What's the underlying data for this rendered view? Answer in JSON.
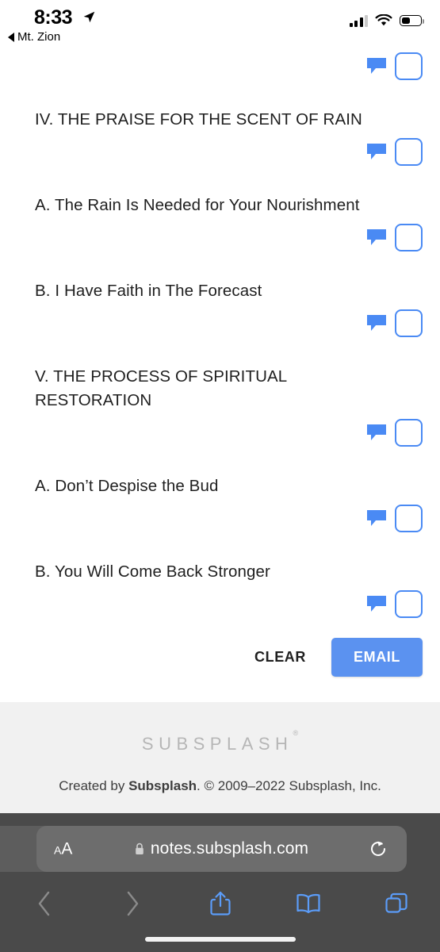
{
  "status_bar": {
    "time": "8:33",
    "location_icon": "location-arrow-icon",
    "back_to_app_label": "Mt. Zion",
    "signal_icon": "cellular-signal-icon",
    "wifi_icon": "wifi-icon",
    "battery_icon": "battery-icon",
    "battery_level_percent": 41
  },
  "notes": {
    "rows": [
      {
        "text": "",
        "comment_icon": "comment-icon",
        "checkbox": "checkbox-icon"
      },
      {
        "text": "IV. THE PRAISE FOR THE SCENT OF RAIN",
        "comment_icon": "comment-icon",
        "checkbox": "checkbox-icon"
      },
      {
        "text": "A. The Rain Is Needed for Your Nourishment",
        "comment_icon": "comment-icon",
        "checkbox": "checkbox-icon"
      },
      {
        "text": "B. I Have Faith in The Forecast",
        "comment_icon": "comment-icon",
        "checkbox": "checkbox-icon"
      },
      {
        "text": "V. THE PROCESS OF SPIRITUAL RESTORATION",
        "comment_icon": "comment-icon",
        "checkbox": "checkbox-icon"
      },
      {
        "text": "A. Don’t Despise the Bud",
        "comment_icon": "comment-icon",
        "checkbox": "checkbox-icon"
      },
      {
        "text": "B. You Will Come Back Stronger",
        "comment_icon": "comment-icon",
        "checkbox": "checkbox-icon"
      }
    ]
  },
  "actions": {
    "clear_label": "CLEAR",
    "email_label": "EMAIL",
    "email_button_color": "#5b92f0",
    "accent_color": "#4a8af4"
  },
  "footer": {
    "logo_text": "SUBSPLASH",
    "logo_mark": "®",
    "credit_prefix": "Created by ",
    "credit_brand": "Subsplash",
    "credit_suffix": ". © 2009–2022 Subsplash, Inc.",
    "background_color": "#f1f1f1"
  },
  "browser": {
    "text_size_small": "A",
    "text_size_large": "A",
    "lock_icon": "lock-icon",
    "url": "notes.subsplash.com",
    "reload_icon": "reload-icon",
    "toolbar": [
      {
        "name": "back-icon",
        "enabled": false
      },
      {
        "name": "forward-icon",
        "enabled": false
      },
      {
        "name": "share-icon",
        "enabled": true
      },
      {
        "name": "bookmarks-icon",
        "enabled": true
      },
      {
        "name": "tabs-icon",
        "enabled": true
      }
    ],
    "chrome_color": "#4a4a4a",
    "urlbar_color": "#6d6d6d",
    "toolbar_accent": "#5b9cf8"
  }
}
